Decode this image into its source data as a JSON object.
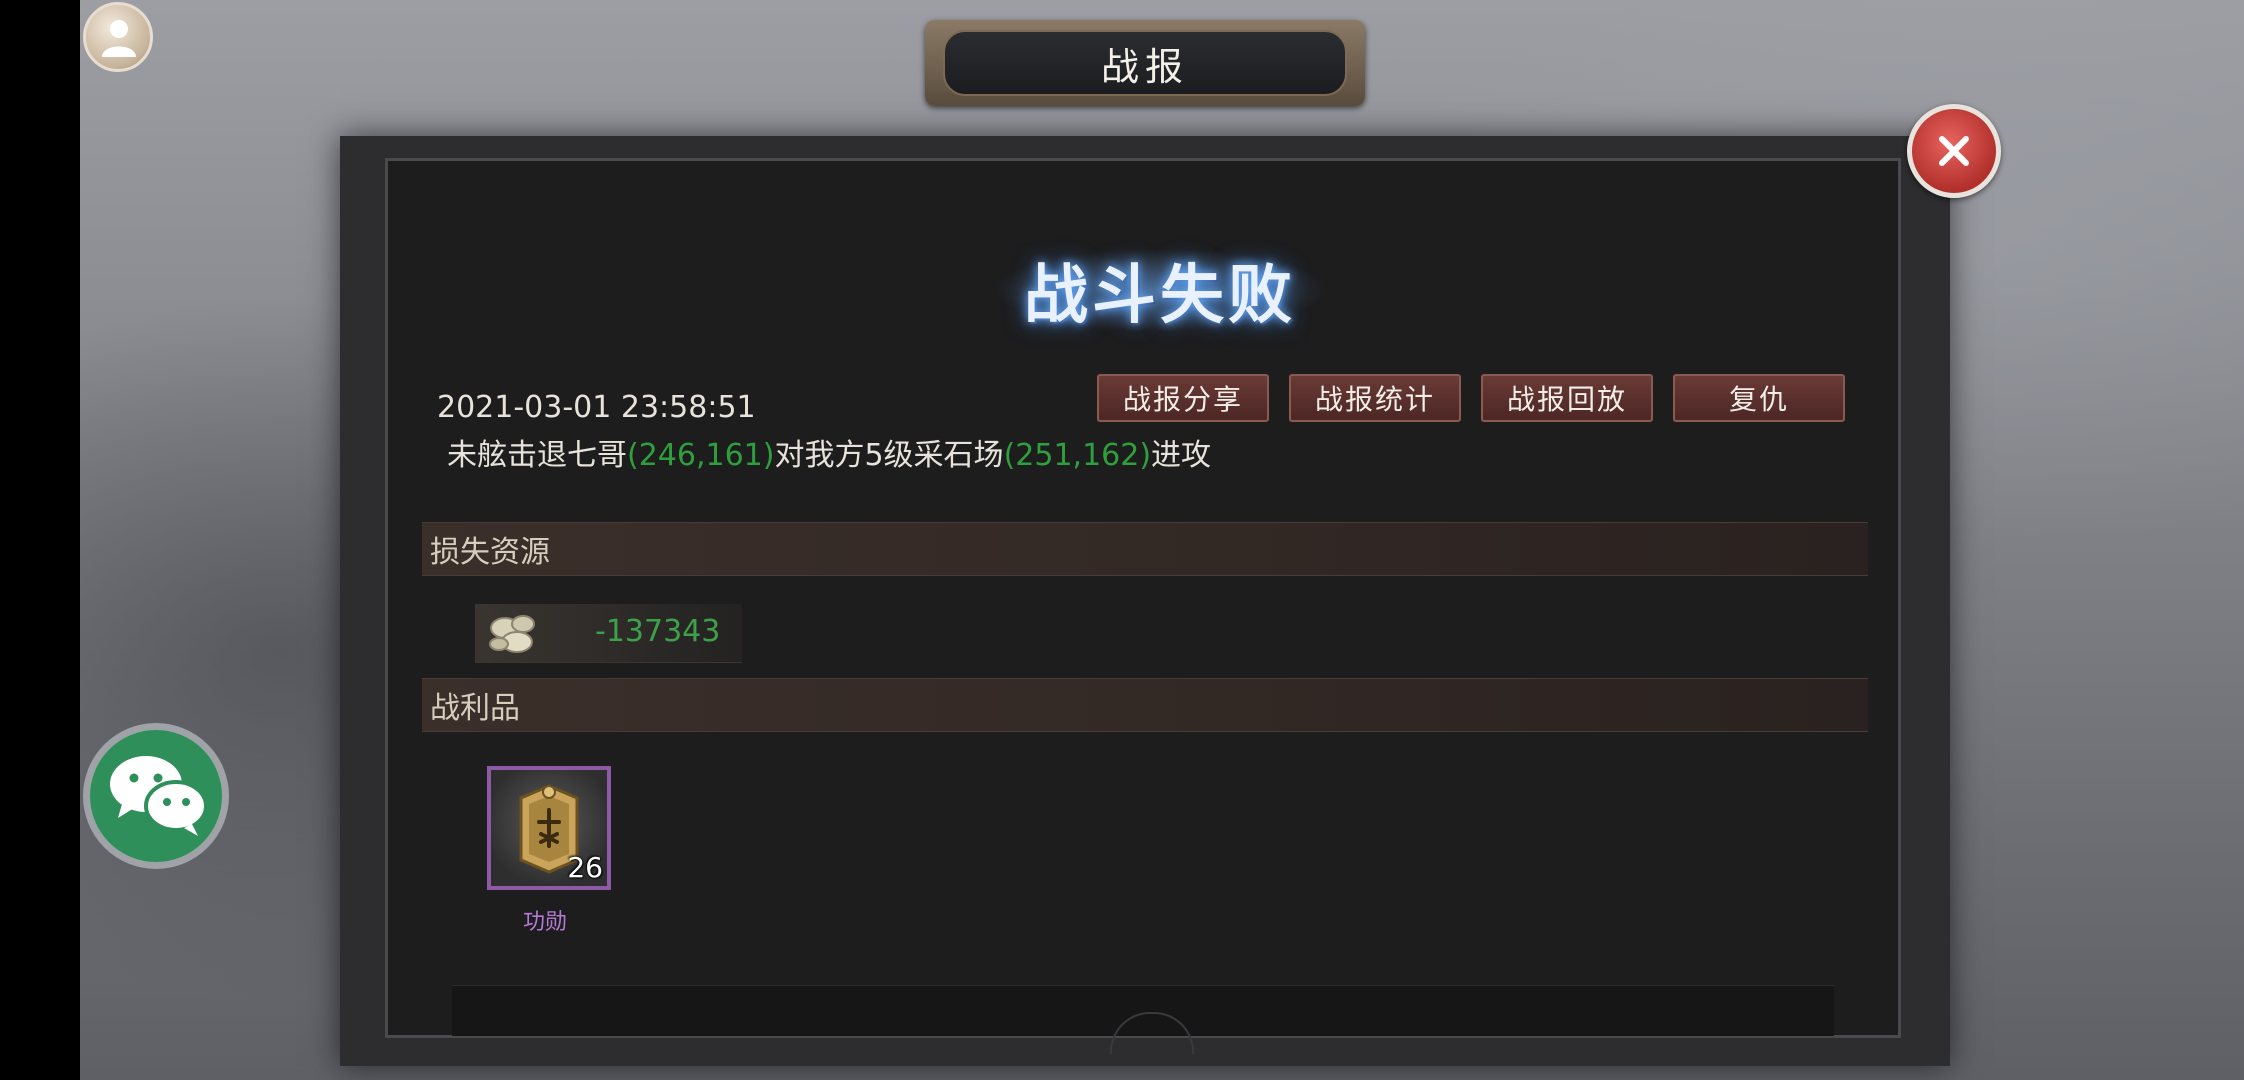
{
  "header": {
    "title": "战报"
  },
  "report": {
    "result": "战斗失败",
    "datetime": "2021-03-01 23:58:51",
    "line": {
      "attacker": "未舷击退七哥",
      "attacker_coord": "(246,161)",
      "middle": "对我方5级采石场",
      "target_coord": "(251,162)",
      "action": "进攻"
    },
    "buttons": {
      "share": "战报分享",
      "stats": "战报统计",
      "replay": "战报回放",
      "revenge": "复仇"
    }
  },
  "lost_resources": {
    "heading": "损失资源",
    "items": [
      {
        "icon": "stone-icon",
        "value": "-137343"
      }
    ]
  },
  "spoils": {
    "heading": "战利品",
    "items": [
      {
        "icon": "merit-token-icon",
        "count": "26",
        "label": "功勋"
      }
    ]
  },
  "colors": {
    "coord_green": "#2f9f3d",
    "loss_green": "#3ea04b",
    "loot_purple": "#b57ad6",
    "close_red": "#c8423d"
  }
}
